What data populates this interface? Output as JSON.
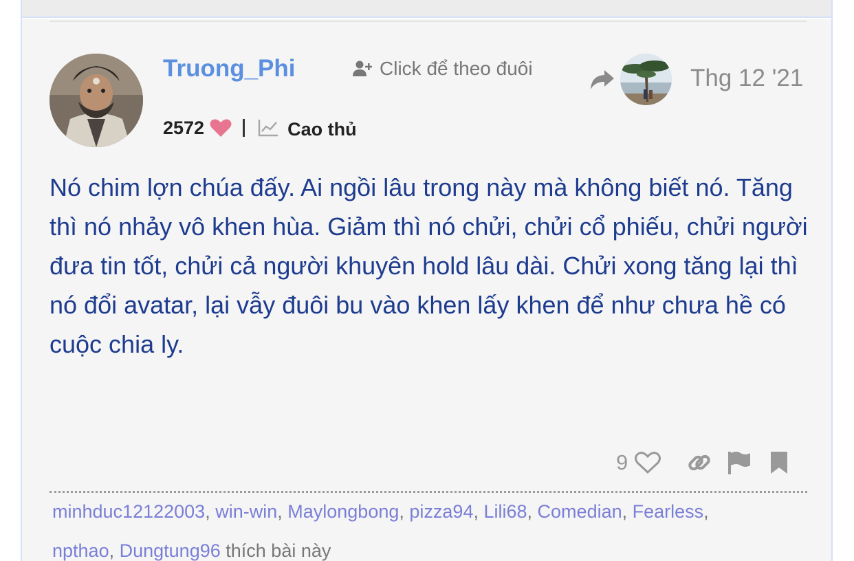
{
  "post": {
    "author": {
      "name": "Truong_Phi",
      "reputation": "2572",
      "rank": "Cao thủ"
    },
    "follow_label": "Click để theo đuôi",
    "date": "Thg 12 '21",
    "body": "Nó chim lợn chúa đấy. Ai ngồi lâu trong này mà không biết nó. Tăng thì nó nhảy vô khen hùa. Giảm thì nó chửi, chửi cổ phiếu, chửi người đưa tin tốt, chửi cả người khuyên hold lâu dài. Chửi xong tăng lại thì nó đổi avatar, lại vẫy đuôi bu vào khen lấy khen để như chưa hề có cuộc chia ly.",
    "like_count": "9",
    "likers": [
      "minhduc12122003",
      "win-win",
      "Maylongbong",
      "pizza94",
      "Lili68",
      "Comedian",
      "Fearless",
      "npthao",
      "Dungtung96"
    ],
    "likers_suffix": "thích bài này"
  },
  "icons": {
    "follow": "add-user-icon",
    "share": "share-arrow-icon",
    "reputation": "heart-icon",
    "rank": "chart-line-icon",
    "like": "heart-outline-icon",
    "link": "link-icon",
    "flag": "flag-icon",
    "bookmark": "bookmark-icon"
  },
  "colors": {
    "username": "#5b8fe0",
    "body_text": "#1e3c8f",
    "liker_links": "#7a7fd6",
    "heart": "#e8758f",
    "background": "#f5f5f5"
  }
}
